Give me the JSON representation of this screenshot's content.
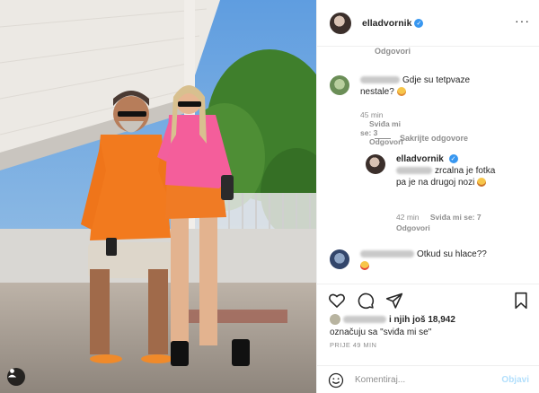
{
  "post": {
    "username": "elladvornik",
    "verified": true
  },
  "comments": {
    "top_reply_link": "Odgovori",
    "c1": {
      "text": "Gdje su tetpvaze nestale?",
      "emoji": "scream",
      "time": "45 min",
      "likes": "Sviđa mi se: 3",
      "reply": "Odgovori"
    },
    "hide_replies": "Sakrijte odgovore",
    "c2": {
      "username": "elladvornik",
      "text": "zrcalna je fotka pa je na drugoj nozi",
      "emoji": "grinning-sweat",
      "time": "42 min",
      "likes": "Sviđa mi se: 7",
      "reply": "Odgovori"
    },
    "c3": {
      "text": "Otkud su hlace??",
      "emoji": "heart-eyes"
    }
  },
  "actions": {
    "likes_suffix": "i njih još 18,942",
    "likes_line2": "označuju sa \"sviđa mi se\"",
    "time_ago": "PRIJE 49 MIN",
    "comment_placeholder": "Komentiraj...",
    "post_button": "Objavi"
  },
  "colors": {
    "accent": "#3897f0",
    "muted": "#8e8e8e",
    "post_disabled": "#b2dffc"
  }
}
